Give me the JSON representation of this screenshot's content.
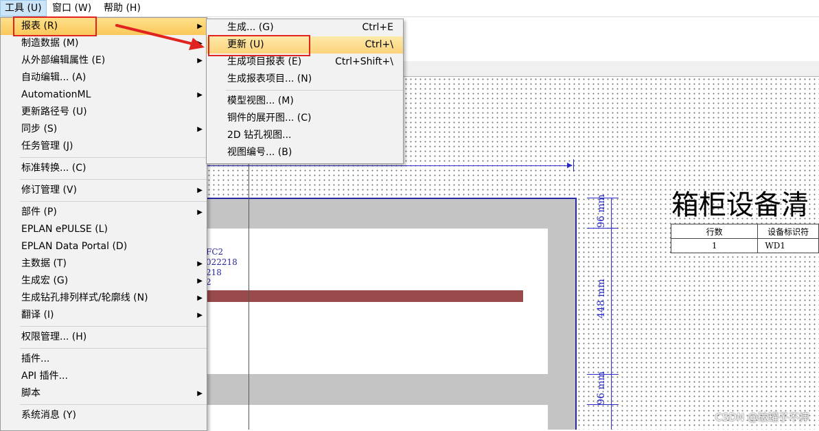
{
  "menubar": {
    "tools": "工具 (U)",
    "window": "窗口 (W)",
    "help": "帮助 (H)"
  },
  "tools_menu": {
    "items": [
      {
        "label": "报表 (R)"
      },
      {
        "label": "制造数据 (M)"
      },
      {
        "label": "从外部编辑属性 (E)"
      },
      {
        "label": "自动编辑... (A)"
      },
      {
        "label": "AutomationML"
      },
      {
        "label": "更新路径号 (U)"
      },
      {
        "label": "同步 (S)"
      },
      {
        "label": "任务管理 (J)"
      },
      {
        "label": "标准转换... (C)"
      },
      {
        "label": "修订管理 (V)"
      },
      {
        "label": "部件 (P)"
      },
      {
        "label": "EPLAN ePULSE (L)"
      },
      {
        "label": "EPLAN Data Portal (D)"
      },
      {
        "label": "主数据 (T)"
      },
      {
        "label": "生成宏 (G)"
      },
      {
        "label": "生成钻孔排列样式/轮廓线 (N)"
      },
      {
        "label": "翻译 (I)"
      },
      {
        "label": "权限管理... (H)"
      },
      {
        "label": "插件..."
      },
      {
        "label": "API 插件..."
      },
      {
        "label": "脚本"
      },
      {
        "label": "系统消息 (Y)"
      }
    ]
  },
  "report_submenu": {
    "items": [
      {
        "label": "生成... (G)",
        "shortcut": "Ctrl+E"
      },
      {
        "label": "更新 (U)",
        "shortcut": "Ctrl+\\"
      },
      {
        "label": "生成项目报表 (E)",
        "shortcut": "Ctrl+Shift+\\"
      },
      {
        "label": "生成报表项目... (N)",
        "shortcut": ""
      },
      {
        "label": "模型视图... (M)",
        "shortcut": ""
      },
      {
        "label": "铜件的展开图... (C)",
        "shortcut": ""
      },
      {
        "label": "2D 钻孔视图...",
        "shortcut": ""
      },
      {
        "label": "视图编号... (B)",
        "shortcut": ""
      }
    ]
  },
  "drawing": {
    "part_labels": [
      "FC2",
      "022218",
      "218",
      "2"
    ],
    "dimensions": [
      "96 mm",
      "448 mm",
      "96 mm"
    ],
    "report_title": "箱柜设备清",
    "table": {
      "headers": [
        "行数",
        "设备标识符"
      ],
      "row": [
        "1",
        "WD1"
      ]
    }
  },
  "watermark": "CSDN @破罐子不摔",
  "colors": {
    "highlight": "#fcd27b",
    "annotation_red": "#e0231e",
    "dimension_blue": "#2828c8"
  }
}
